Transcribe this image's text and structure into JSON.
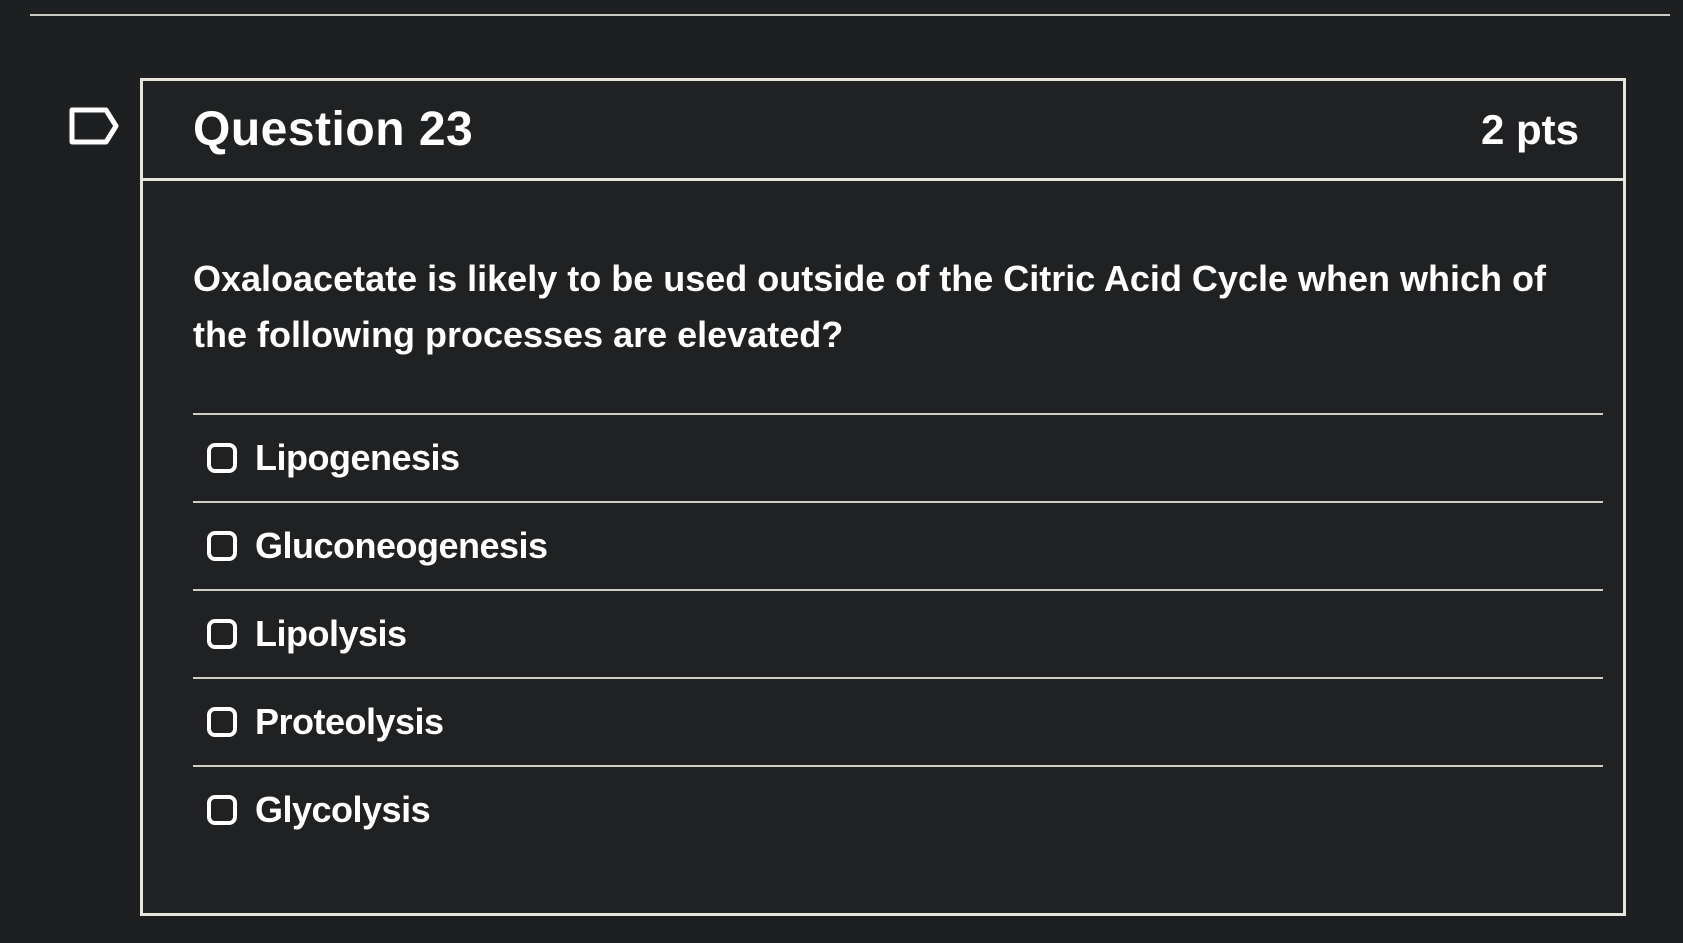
{
  "question": {
    "title": "Question 23",
    "points": "2 pts",
    "text": "Oxaloacetate is likely to be used outside of the Citric Acid Cycle when which of the following processes are elevated?",
    "answers": [
      {
        "label": "Lipogenesis"
      },
      {
        "label": "Gluconeogenesis"
      },
      {
        "label": "Lipolysis"
      },
      {
        "label": "Proteolysis"
      },
      {
        "label": "Glycolysis"
      }
    ]
  },
  "icons": {
    "flag": "bookmark-flag-icon",
    "checkbox": "checkbox-unchecked-icon"
  },
  "colors": {
    "background": "#1d1f20",
    "border": "#e8e6dc",
    "text": "#ffffff"
  }
}
